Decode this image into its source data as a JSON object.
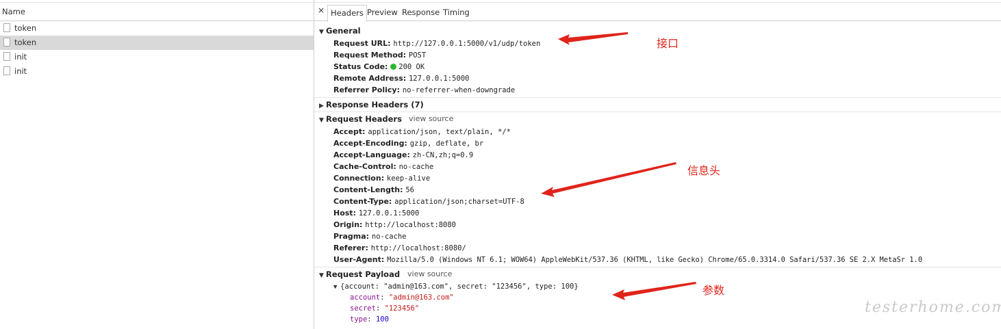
{
  "network_list": {
    "column_header": "Name",
    "requests": [
      {
        "name": "token",
        "selected": false
      },
      {
        "name": "token",
        "selected": true
      },
      {
        "name": "init",
        "selected": false
      },
      {
        "name": "init",
        "selected": false
      }
    ]
  },
  "tabs": {
    "close_glyph": "×",
    "items": [
      "Headers",
      "Preview",
      "Response",
      "Timing"
    ],
    "active": "Headers"
  },
  "general": {
    "title": "General",
    "rows": [
      {
        "key": "Request URL:",
        "value": "http://127.0.0.1:5000/v1/udp/token"
      },
      {
        "key": "Request Method:",
        "value": "POST"
      },
      {
        "key": "Status Code:",
        "value": "200 OK"
      },
      {
        "key": "Remote Address:",
        "value": "127.0.0.1:5000"
      },
      {
        "key": "Referrer Policy:",
        "value": "no-referrer-when-downgrade"
      }
    ]
  },
  "response_headers": {
    "title": "Response Headers (7)"
  },
  "request_headers": {
    "title": "Request Headers",
    "view_source": "view source",
    "rows": [
      {
        "key": "Accept:",
        "value": "application/json, text/plain, */*"
      },
      {
        "key": "Accept-Encoding:",
        "value": "gzip, deflate, br"
      },
      {
        "key": "Accept-Language:",
        "value": "zh-CN,zh;q=0.9"
      },
      {
        "key": "Cache-Control:",
        "value": "no-cache"
      },
      {
        "key": "Connection:",
        "value": "keep-alive"
      },
      {
        "key": "Content-Length:",
        "value": "56"
      },
      {
        "key": "Content-Type:",
        "value": "application/json;charset=UTF-8"
      },
      {
        "key": "Host:",
        "value": "127.0.0.1:5000"
      },
      {
        "key": "Origin:",
        "value": "http://localhost:8080"
      },
      {
        "key": "Pragma:",
        "value": "no-cache"
      },
      {
        "key": "Referer:",
        "value": "http://localhost:8080/"
      },
      {
        "key": "User-Agent:",
        "value": "Mozilla/5.0 (Windows NT 6.1; WOW64) AppleWebKit/537.36 (KHTML, like Gecko) Chrome/65.0.3314.0 Safari/537.36 SE 2.X MetaSr 1.0"
      }
    ]
  },
  "request_payload": {
    "title": "Request Payload",
    "view_source": "view source",
    "summary": "{account: \"admin@163.com\", secret: \"123456\", type: 100}",
    "fields": [
      {
        "key": "account",
        "value": "\"admin@163.com\"",
        "kind": "string"
      },
      {
        "key": "secret",
        "value": "\"123456\"",
        "kind": "string"
      },
      {
        "key": "type",
        "value": "100",
        "kind": "number"
      }
    ]
  },
  "annotations": {
    "interface": "接口",
    "headers": "信息头",
    "params": "参数",
    "color": "#e0241b"
  },
  "watermark": "testerhome.com",
  "colors": {
    "status_ok": "#2cb82c",
    "payload_key": "#881391",
    "payload_string": "#c41a16",
    "payload_number": "#1c00cf"
  }
}
